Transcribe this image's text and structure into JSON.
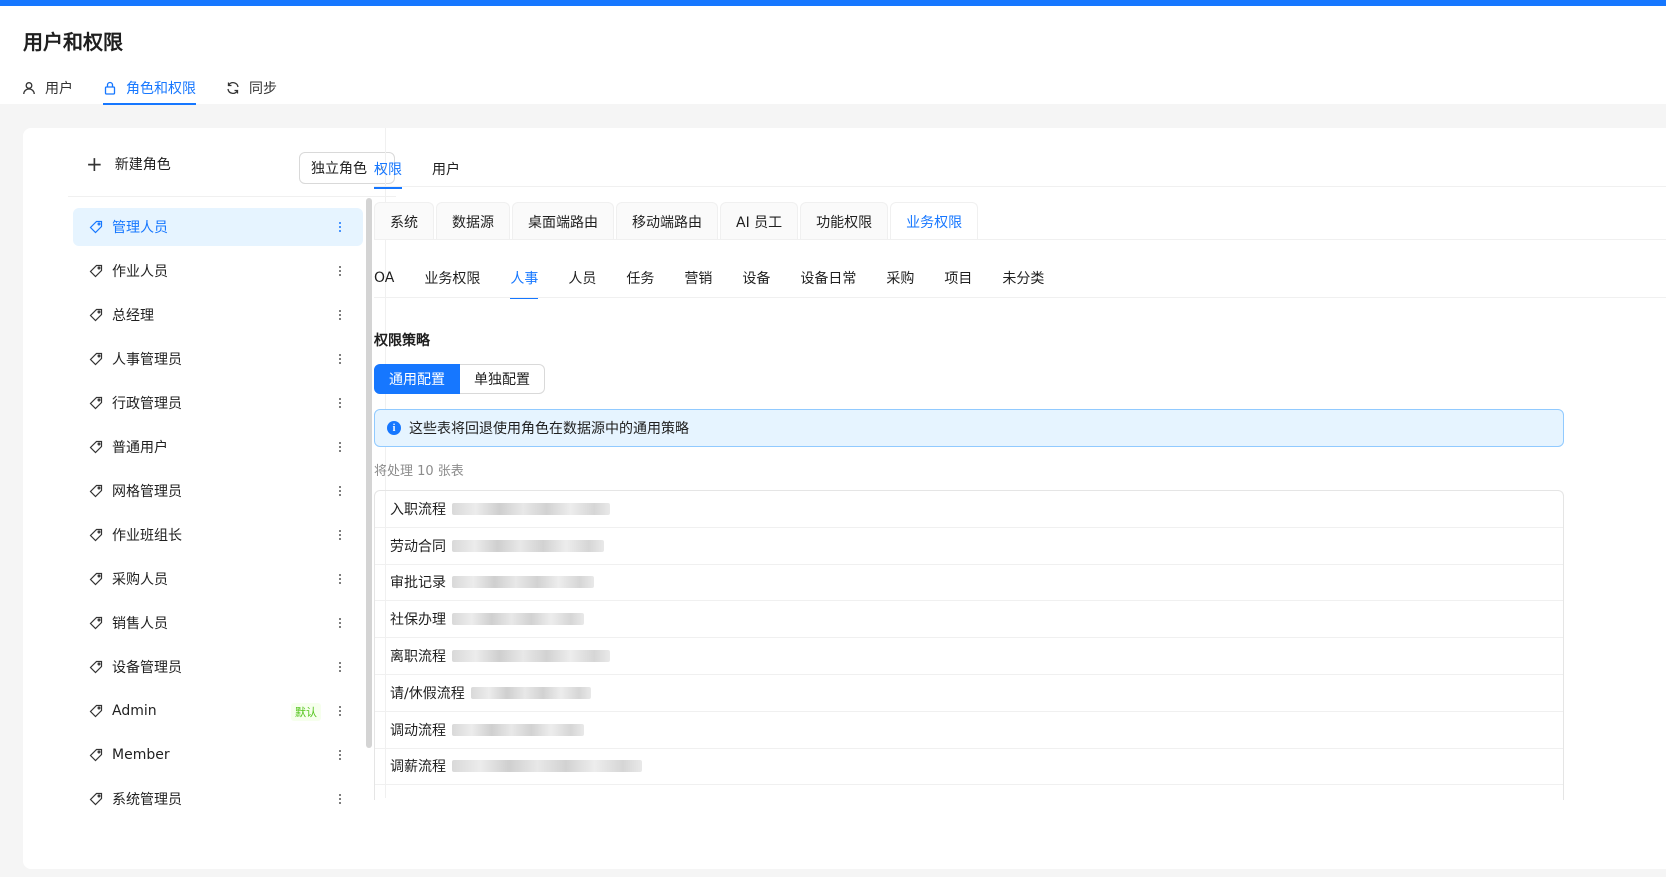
{
  "header": {
    "title": "用户和权限",
    "tabs": [
      {
        "label": "用户",
        "icon": "user-icon"
      },
      {
        "label": "角色和权限",
        "icon": "lock-icon"
      },
      {
        "label": "同步",
        "icon": "sync-icon"
      }
    ]
  },
  "left_panel": {
    "new_role_label": "新建角色",
    "role_mode_select": "独立角色",
    "roles": [
      {
        "label": "管理人员"
      },
      {
        "label": "作业人员"
      },
      {
        "label": "总经理"
      },
      {
        "label": "人事管理员"
      },
      {
        "label": "行政管理员"
      },
      {
        "label": "普通用户"
      },
      {
        "label": "网格管理员"
      },
      {
        "label": "作业班组长"
      },
      {
        "label": "采购人员"
      },
      {
        "label": "销售人员"
      },
      {
        "label": "设备管理员"
      },
      {
        "label": "Admin",
        "badge": "默认"
      },
      {
        "label": "Member"
      },
      {
        "label": "系统管理员"
      }
    ]
  },
  "right_panel": {
    "sub_tabs": [
      "权限",
      "用户"
    ],
    "card_tabs": [
      "系统",
      "数据源",
      "桌面端路由",
      "移动端路由",
      "AI 员工",
      "功能权限",
      "业务权限"
    ],
    "category_tabs": [
      "OA",
      "业务权限",
      "人事",
      "人员",
      "任务",
      "营销",
      "设备",
      "设备日常",
      "采购",
      "项目",
      "未分类"
    ],
    "section_title": "权限策略",
    "config_buttons": [
      "通用配置",
      "单独配置"
    ],
    "alert_text": "这些表将回退使用角色在数据源中的通用策略",
    "count_text": "将处理 10 张表",
    "tables": [
      {
        "name": "入职流程"
      },
      {
        "name": "劳动合同"
      },
      {
        "name": "审批记录"
      },
      {
        "name": "社保办理"
      },
      {
        "name": "离职流程"
      },
      {
        "name": "请/休假流程"
      },
      {
        "name": "调动流程"
      },
      {
        "name": "调薪流程"
      }
    ]
  },
  "colors": {
    "accent": "#1677ff",
    "active_bg": "#e6f4ff",
    "badge_green": "#52c41a"
  }
}
